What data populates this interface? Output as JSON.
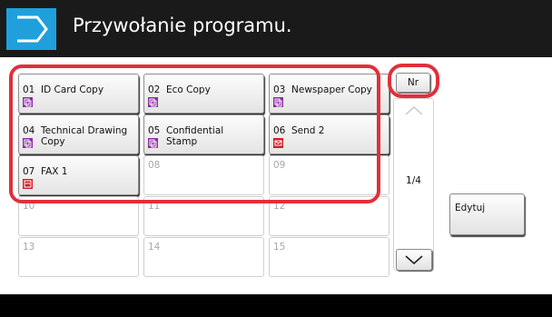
{
  "header": {
    "title": "Przywołanie programu."
  },
  "programs": [
    {
      "num": "01",
      "label": "ID Card Copy",
      "icon": "copy-icon"
    },
    {
      "num": "02",
      "label": "Eco Copy",
      "icon": "copy-icon"
    },
    {
      "num": "03",
      "label": "Newspaper Copy",
      "icon": "copy-icon"
    },
    {
      "num": "04",
      "label": "Technical Drawing\nCopy",
      "icon": "copy-icon"
    },
    {
      "num": "05",
      "label": "Confidential\nStamp",
      "icon": "copy-icon"
    },
    {
      "num": "06",
      "label": "Send 2",
      "icon": "send-icon"
    },
    {
      "num": "07",
      "label": "FAX 1",
      "icon": "fax-icon"
    },
    {
      "num": "08",
      "label": ""
    },
    {
      "num": "09",
      "label": ""
    },
    {
      "num": "10",
      "label": ""
    },
    {
      "num": "11",
      "label": ""
    },
    {
      "num": "12",
      "label": ""
    },
    {
      "num": "13",
      "label": ""
    },
    {
      "num": "14",
      "label": ""
    },
    {
      "num": "15",
      "label": ""
    }
  ],
  "controls": {
    "nr_label": "Nr",
    "page_indicator": "1/4",
    "edit_label": "Edytuj"
  },
  "colors": {
    "header_accent": "#1fa0dd",
    "highlight": "#e0303a",
    "copy_icon": "#8e2ba5",
    "send_icon": "#d0202a",
    "fax_icon": "#d0202a"
  }
}
